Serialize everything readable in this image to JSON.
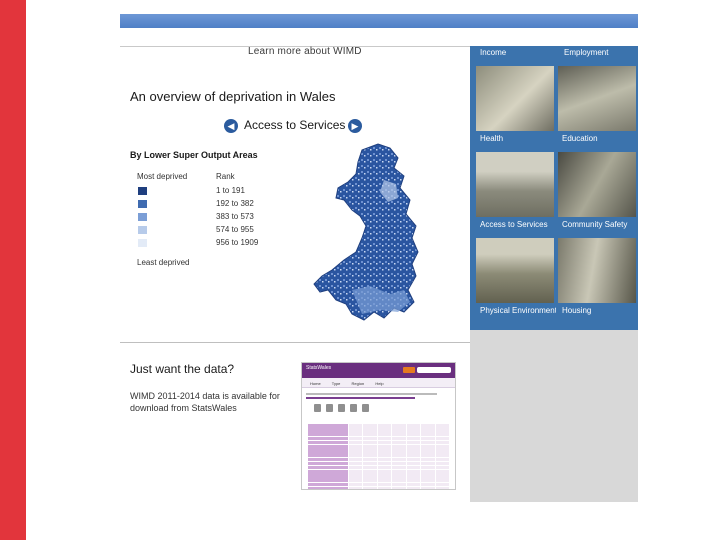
{
  "header": {
    "learn_more": "Learn more about WIMD"
  },
  "overview": {
    "title": "An overview of deprivation in Wales",
    "access_label": "Access to Services",
    "subhead": "By Lower Super Output Areas",
    "legend_col1": "Most deprived",
    "legend_col2": "Rank",
    "legend_rows": [
      {
        "range": "1 to 191",
        "color": "#1f3f7f"
      },
      {
        "range": "192 to 382",
        "color": "#3f6bb0"
      },
      {
        "range": "383 to 573",
        "color": "#7b9ed6"
      },
      {
        "range": "574 to 955",
        "color": "#b7cbea"
      },
      {
        "range": "956 to 1909",
        "color": "#e3ebf7"
      }
    ],
    "least_deprived": "Least deprived"
  },
  "just_data": {
    "title": "Just want the data?",
    "text": "WIMD 2011-2014 data is available for download from StatsWales"
  },
  "statswales": {
    "brand": "StatsWales",
    "nav": [
      "Home",
      "Type",
      "Region",
      "Help"
    ]
  },
  "tiles": {
    "top_labels": [
      "Income",
      "Employment"
    ],
    "items": [
      {
        "label": "Health"
      },
      {
        "label": "Education"
      },
      {
        "label": "Access to Services"
      },
      {
        "label": "Community Safety"
      },
      {
        "label": "Physical Environment"
      },
      {
        "label": "Housing"
      }
    ]
  },
  "colors": {
    "accent_red": "#e2353c",
    "tile_blue": "#3b73ad",
    "statswales_purple": "#6a2f7f"
  }
}
